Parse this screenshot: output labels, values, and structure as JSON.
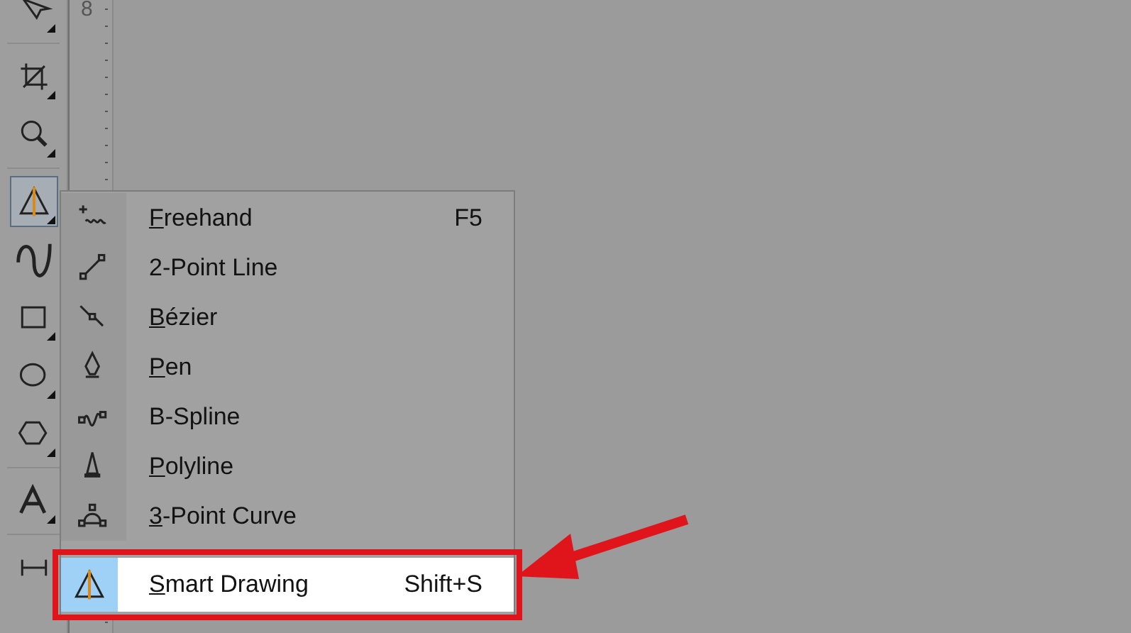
{
  "toolbox": [
    {
      "kind": "shape",
      "selected": false,
      "has_flyout": true
    },
    {
      "kind": "crop",
      "selected": false,
      "has_flyout": true
    },
    {
      "kind": "zoom",
      "selected": false,
      "has_flyout": true
    },
    {
      "kind": "smart",
      "selected": true,
      "has_flyout": true
    },
    {
      "kind": "curve",
      "selected": false,
      "has_flyout": false
    },
    {
      "kind": "rectangle",
      "selected": false,
      "has_flyout": true
    },
    {
      "kind": "ellipse",
      "selected": false,
      "has_flyout": true
    },
    {
      "kind": "polygon",
      "selected": false,
      "has_flyout": true
    },
    {
      "kind": "text",
      "selected": false,
      "has_flyout": true
    },
    {
      "kind": "dimension",
      "selected": false,
      "has_flyout": false
    }
  ],
  "ruler": {
    "label": "8"
  },
  "flyout_menu": [
    {
      "kind": "freehand",
      "label": "Freehand",
      "underline_first": true,
      "shortcut": "F5",
      "highlighted": false
    },
    {
      "kind": "line",
      "label": "2-Point Line",
      "underline_first": false,
      "highlighted": false
    },
    {
      "kind": "bezier",
      "label": "Bézier",
      "underline_first": true,
      "highlighted": false
    },
    {
      "kind": "pen",
      "label": "Pen",
      "underline_first": true,
      "highlighted": false
    },
    {
      "kind": "bspline",
      "label": "B-Spline",
      "underline_first": false,
      "highlighted": false
    },
    {
      "kind": "polyline",
      "label": "Polyline",
      "underline_first": true,
      "highlighted": false
    },
    {
      "kind": "curve3",
      "label": "3-Point Curve",
      "underline_first": true,
      "highlighted": false
    },
    {
      "kind": "smart",
      "label": "Smart Drawing",
      "underline_first": true,
      "shortcut": "Shift+S",
      "highlighted": true,
      "annotated": true
    }
  ]
}
